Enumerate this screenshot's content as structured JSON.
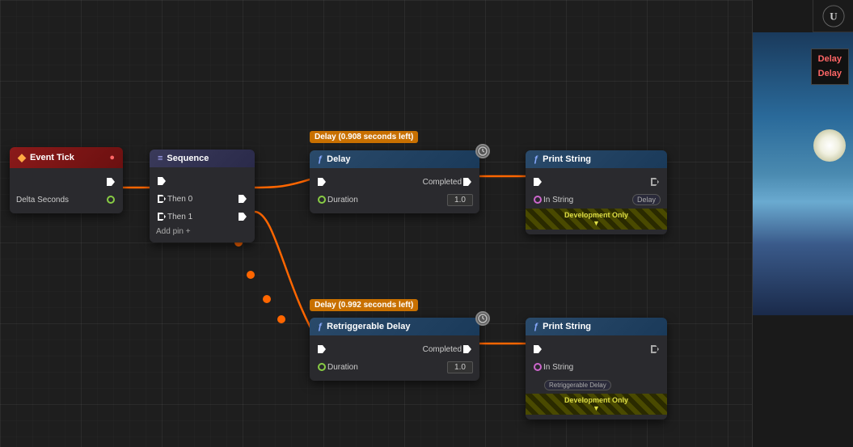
{
  "canvas": {
    "background_color": "#1e1e1e"
  },
  "nodes": {
    "event_tick": {
      "title": "Event Tick",
      "output_pin": "►",
      "delta_seconds_label": "Delta Seconds"
    },
    "sequence": {
      "title": "Sequence",
      "then0_label": "Then 0",
      "then1_label": "Then 1",
      "add_pin_label": "Add pin +"
    },
    "delay_top": {
      "timer_badge": "Delay (0.908 seconds left)",
      "title": "Delay",
      "completed_label": "Completed",
      "duration_label": "Duration",
      "duration_value": "1.0"
    },
    "print_string_top": {
      "title": "Print String",
      "in_string_label": "In String",
      "in_string_value": "Delay",
      "development_only_label": "Development Only"
    },
    "delay_bottom": {
      "timer_badge": "Delay (0.992 seconds left)",
      "title": "Retriggerable Delay",
      "completed_label": "Completed",
      "duration_label": "Duration",
      "duration_value": "1.0"
    },
    "print_string_bottom": {
      "title": "Print String",
      "in_string_label": "In String",
      "in_string_value": "Retriggerable Delay",
      "development_only_label": "Development Only"
    }
  },
  "right_panel": {
    "tooltip": {
      "line1": "Delay",
      "line2": "Delay"
    }
  },
  "icons": {
    "ue_logo": "U",
    "chevron_down": "▼"
  }
}
